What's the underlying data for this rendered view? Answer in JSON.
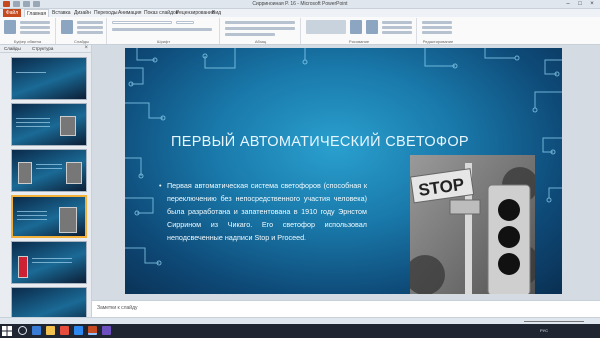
{
  "window": {
    "title": "Сирриноиная Р. 16  -  Microsoft PowerPoint",
    "controls": [
      "–",
      "□",
      "×"
    ]
  },
  "menu": {
    "file": "Файл",
    "tabs": [
      "Главная",
      "Вставка",
      "Дизайн",
      "Переходы",
      "Анимация",
      "Показ слайдов",
      "Рецензирование",
      "Вид"
    ]
  },
  "ribbon": {
    "groups": [
      "Буфер обмена",
      "Слайды",
      "Шрифт",
      "Абзац",
      "Рисование",
      "Редактирование"
    ],
    "buttons": {
      "paste": "Вставить",
      "new_slide": "Создать слайд",
      "find": "Найти",
      "replace": "Заменить",
      "select": "Выделить"
    }
  },
  "left_panel": {
    "tab_slides": "Слайды",
    "tab_outline": "Структура",
    "close": "×",
    "thumbnails": [
      {
        "num": "",
        "title": ""
      },
      {
        "num": "",
        "title": ""
      },
      {
        "num": "",
        "title": ""
      },
      {
        "num": "",
        "title": ""
      },
      {
        "num": "",
        "title": ""
      },
      {
        "num": "",
        "title": ""
      }
    ]
  },
  "slide": {
    "title": "ПЕРВЫЙ АВТОМАТИЧЕСКИЙ СВЕТОФОР",
    "bullet": "Первая автоматическая система светофоров (способная к переключению без непосредственного участия человека) была разработана и запатентована в 1910 году Эрнстом Сиррином из Чикаго. Его светофор использовал неподсвеченные надписи Stop и Proceed.",
    "photo_sign": "STOP"
  },
  "notes": {
    "placeholder": "Заметки к слайду"
  },
  "status": {
    "slide_info": "",
    "theme": "",
    "language": "",
    "zoom": ""
  },
  "taskbar": {
    "lang": "РУС",
    "time": "",
    "date": ""
  }
}
